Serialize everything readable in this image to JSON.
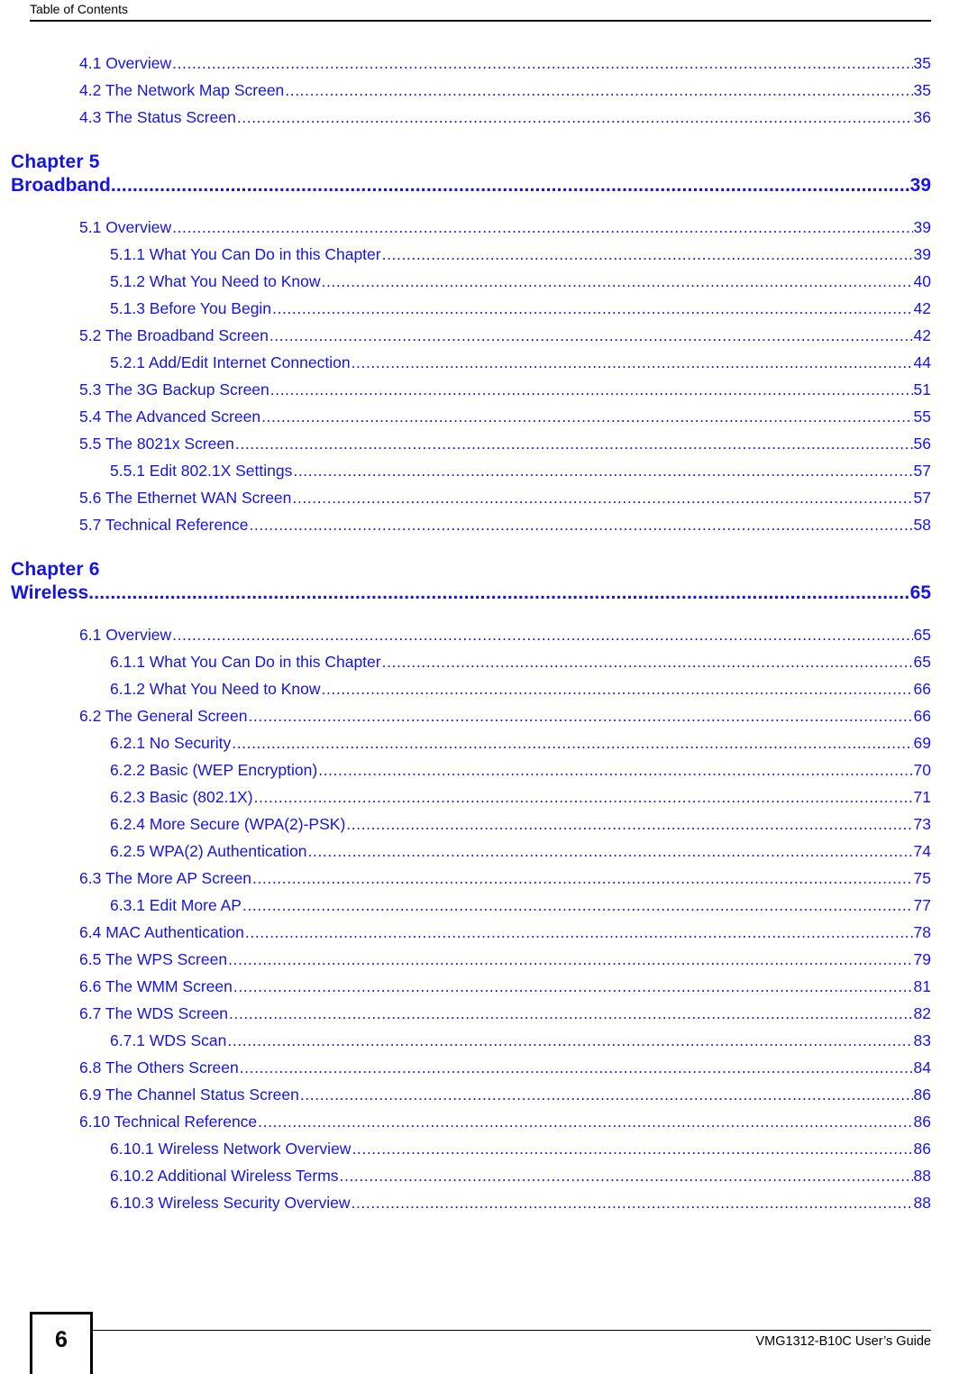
{
  "header": {
    "title": "Table of Contents"
  },
  "footer": {
    "page_number": "6",
    "guide_title": "VMG1312-B10C User’s Guide"
  },
  "colors": {
    "link_blue": "#1414e6",
    "text_black": "#000000",
    "page_background": "#ffffff"
  },
  "toc": {
    "leading_entries": [
      {
        "label": "4.1 Overview ",
        "page": "35",
        "level": 1
      },
      {
        "label": "4.2 The Network Map Screen ",
        "page": "35",
        "level": 1
      },
      {
        "label": "4.3 The Status Screen ",
        "page": "36",
        "level": 1
      }
    ],
    "chapters": [
      {
        "kicker": "Chapter   5",
        "title": "Broadband",
        "page": "39",
        "entries": [
          {
            "label": "5.1 Overview ",
            "page": "39",
            "level": 1
          },
          {
            "label": "5.1.1 What You Can Do in this Chapter ",
            "page": "39",
            "level": 2
          },
          {
            "label": "5.1.2 What You Need to Know ",
            "page": "40",
            "level": 2
          },
          {
            "label": "5.1.3 Before You Begin ",
            "page": "42",
            "level": 2
          },
          {
            "label": "5.2 The Broadband Screen ",
            "page": "42",
            "level": 1
          },
          {
            "label": "5.2.1 Add/Edit Internet Connection ",
            "page": "44",
            "level": 2
          },
          {
            "label": "5.3 The 3G Backup Screen ",
            "page": "51",
            "level": 1
          },
          {
            "label": "5.4 The Advanced Screen ",
            "page": "55",
            "level": 1
          },
          {
            "label": "5.5 The 8021x Screen ",
            "page": "56",
            "level": 1
          },
          {
            "label": "5.5.1 Edit 802.1X Settings ",
            "page": "57",
            "level": 2
          },
          {
            "label": "5.6 The Ethernet WAN Screen ",
            "page": "57",
            "level": 1
          },
          {
            "label": "5.7 Technical Reference ",
            "page": "58",
            "level": 1
          }
        ]
      },
      {
        "kicker": "Chapter   6",
        "title": "Wireless",
        "page": "65",
        "entries": [
          {
            "label": "6.1 Overview ",
            "page": "65",
            "level": 1
          },
          {
            "label": "6.1.1 What You Can Do in this Chapter ",
            "page": "65",
            "level": 2
          },
          {
            "label": "6.1.2 What You Need to Know ",
            "page": "66",
            "level": 2
          },
          {
            "label": "6.2 The General Screen  ",
            "page": "66",
            "level": 1
          },
          {
            "label": "6.2.1 No Security ",
            "page": "69",
            "level": 2
          },
          {
            "label": "6.2.2 Basic (WEP Encryption) ",
            "page": "70",
            "level": 2
          },
          {
            "label": "6.2.3 Basic (802.1X) ",
            "page": "71",
            "level": 2
          },
          {
            "label": "6.2.4 More Secure (WPA(2)-PSK) ",
            "page": "73",
            "level": 2
          },
          {
            "label": "6.2.5 WPA(2) Authentication ",
            "page": "74",
            "level": 2
          },
          {
            "label": "6.3 The More AP Screen ",
            "page": "75",
            "level": 1
          },
          {
            "label": "6.3.1 Edit More AP   ",
            "page": "77",
            "level": 2
          },
          {
            "label": "6.4 MAC Authentication  ",
            "page": "78",
            "level": 1
          },
          {
            "label": "6.5 The WPS Screen  ",
            "page": "79",
            "level": 1
          },
          {
            "label": "6.6 The WMM Screen  ",
            "page": "81",
            "level": 1
          },
          {
            "label": "6.7 The WDS Screen  ",
            "page": "82",
            "level": 1
          },
          {
            "label": "6.7.1 WDS Scan  ",
            "page": "83",
            "level": 2
          },
          {
            "label": "6.8 The Others Screen ",
            "page": "84",
            "level": 1
          },
          {
            "label": "6.9 The Channel Status Screen  ",
            "page": "86",
            "level": 1
          },
          {
            "label": "6.10 Technical Reference ",
            "page": "86",
            "level": 1
          },
          {
            "label": "6.10.1 Wireless Network Overview ",
            "page": "86",
            "level": 2
          },
          {
            "label": "6.10.2 Additional Wireless Terms  ",
            "page": "88",
            "level": 2
          },
          {
            "label": "6.10.3 Wireless Security Overview ",
            "page": "88",
            "level": 2
          }
        ]
      }
    ]
  }
}
